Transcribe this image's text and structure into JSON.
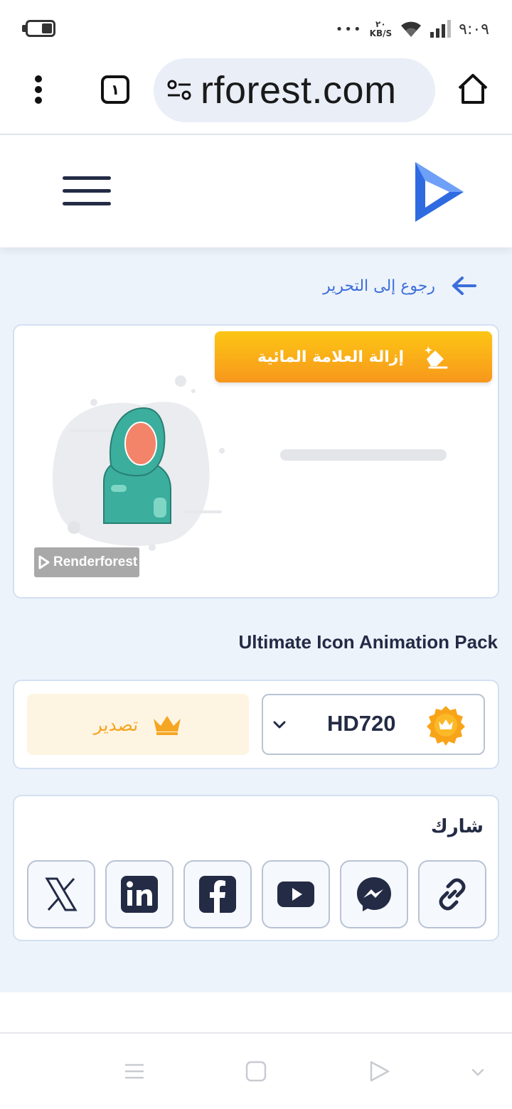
{
  "status_bar": {
    "clock": "٩:٠٩",
    "speed_value": "٢٠",
    "speed_unit": "KB/S",
    "dots": "•••"
  },
  "browser": {
    "tab_count": "١",
    "url": "rforest.com"
  },
  "main": {
    "back_label": "رجوع إلى التحرير",
    "watermark_button": "إزالة العلامة المائية",
    "watermark_badge_text": "Renderforest",
    "project_title": "Ultimate Icon Animation Pack",
    "export_label": "تصدير",
    "quality_value": "HD720",
    "share_title": "شارك"
  },
  "colors": {
    "accent_blue": "#3c6fd9",
    "accent_orange": "#f7971c",
    "navy": "#232b45",
    "page_bg": "#edf3fb"
  },
  "share_icons": [
    "x-icon",
    "linkedin-icon",
    "facebook-icon",
    "youtube-icon",
    "messenger-icon",
    "link-icon"
  ]
}
